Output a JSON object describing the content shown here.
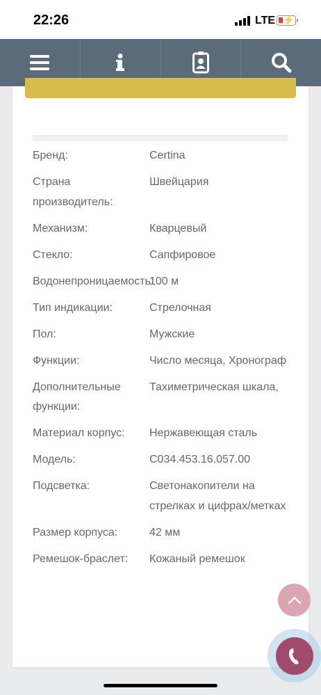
{
  "status_bar": {
    "time": "22:26",
    "network": "LTE"
  },
  "navbar": {
    "items": [
      {
        "icon": "menu-icon"
      },
      {
        "icon": "info-icon"
      },
      {
        "icon": "contact-card-icon"
      },
      {
        "icon": "search-icon"
      }
    ],
    "background": "#5b6b79"
  },
  "specs": [
    {
      "label": "Бренд:",
      "value": "Certina"
    },
    {
      "label": "Страна производитель:",
      "value": "Швейцария"
    },
    {
      "label": "Механизм:",
      "value": "Кварцевый"
    },
    {
      "label": "Стекло:",
      "value": "Сапфировое"
    },
    {
      "label": "Водонепроницаемость:",
      "value": "100 м"
    },
    {
      "label": "Тип индикации:",
      "value": "Стрелочная"
    },
    {
      "label": "Пол:",
      "value": "Мужские"
    },
    {
      "label": "Функции:",
      "value": "Число месяца, Хронограф"
    },
    {
      "label": "Дополнительные функции:",
      "value": "Тахиметрическая шкала,"
    },
    {
      "label": "Материал корпус:",
      "value": "Нержавеющая сталь"
    },
    {
      "label": "Модель:",
      "value": "C034.453.16.057.00"
    },
    {
      "label": "Подсветка:",
      "value": "Светонакопители на стрелках и цифрах/метках"
    },
    {
      "label": "Размер корпуса:",
      "value": "42 мм"
    },
    {
      "label": "Ремешок-браслет:",
      "value": "Кожаный ремешок"
    }
  ],
  "colors": {
    "accent_yellow": "#d7bd4d",
    "scroll_top_pink": "#dca5b3",
    "call_purple": "#a14b6a"
  }
}
